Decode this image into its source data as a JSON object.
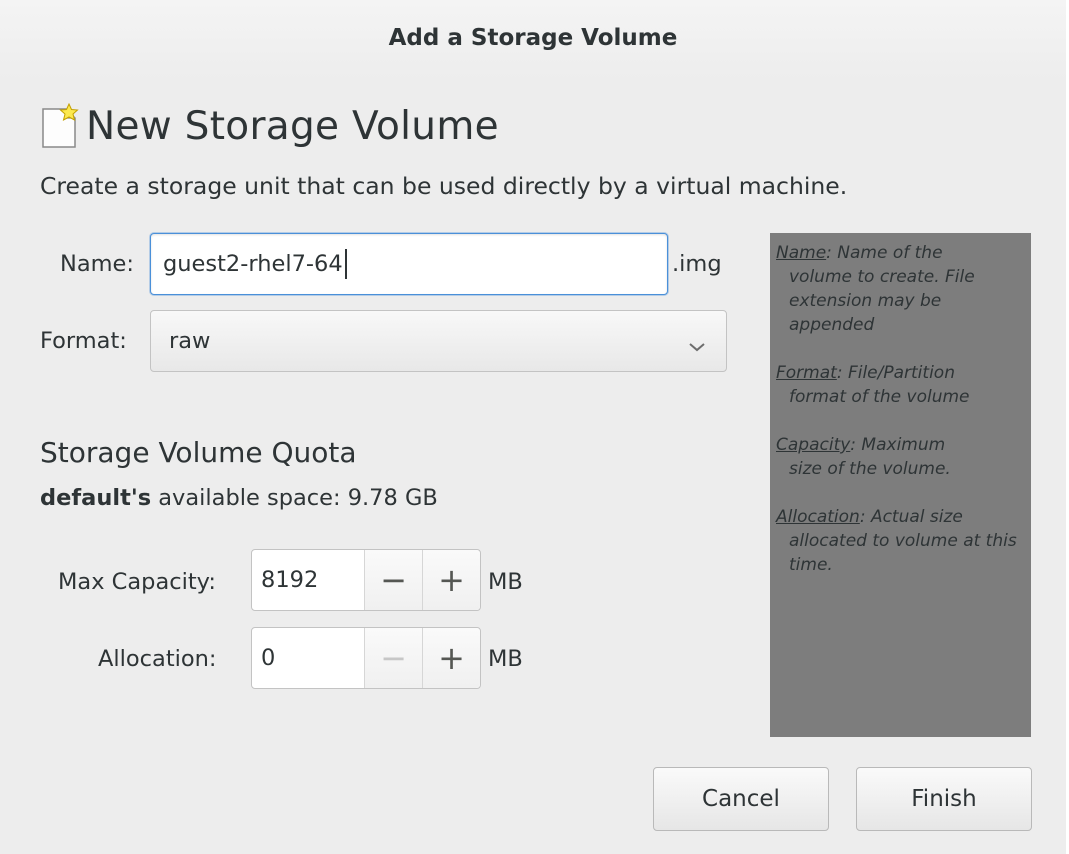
{
  "window": {
    "title": "Add a Storage Volume"
  },
  "header": {
    "icon": "new-document-icon",
    "title": "New Storage Volume",
    "subtitle": "Create a storage unit that can be used directly by a virtual machine."
  },
  "form": {
    "name_label": "Name:",
    "name_value": "guest2-rhel7-64",
    "name_suffix": ".img",
    "format_label": "Format:",
    "format_value": "raw"
  },
  "quota": {
    "title": "Storage Volume Quota",
    "pool_name": "default's",
    "available_text": "available space: 9.78 GB",
    "max_capacity_label": "Max Capacity:",
    "max_capacity_value": "8192",
    "allocation_label": "Allocation:",
    "allocation_value": "0",
    "unit": "MB",
    "minus": "−",
    "plus": "+"
  },
  "help": {
    "entries": [
      {
        "key": "Name",
        "text": ": Name of the",
        "body": "volume to create. File extension may be appended"
      },
      {
        "key": "Format",
        "text": ": File/Partition",
        "body": "format of the volume"
      },
      {
        "key": "Capacity",
        "text": ": Maximum",
        "body": "size of the volume."
      },
      {
        "key": "Allocation",
        "text": ": Actual size",
        "body": "allocated to volume at this time."
      }
    ]
  },
  "buttons": {
    "cancel": "Cancel",
    "finish": "Finish"
  }
}
